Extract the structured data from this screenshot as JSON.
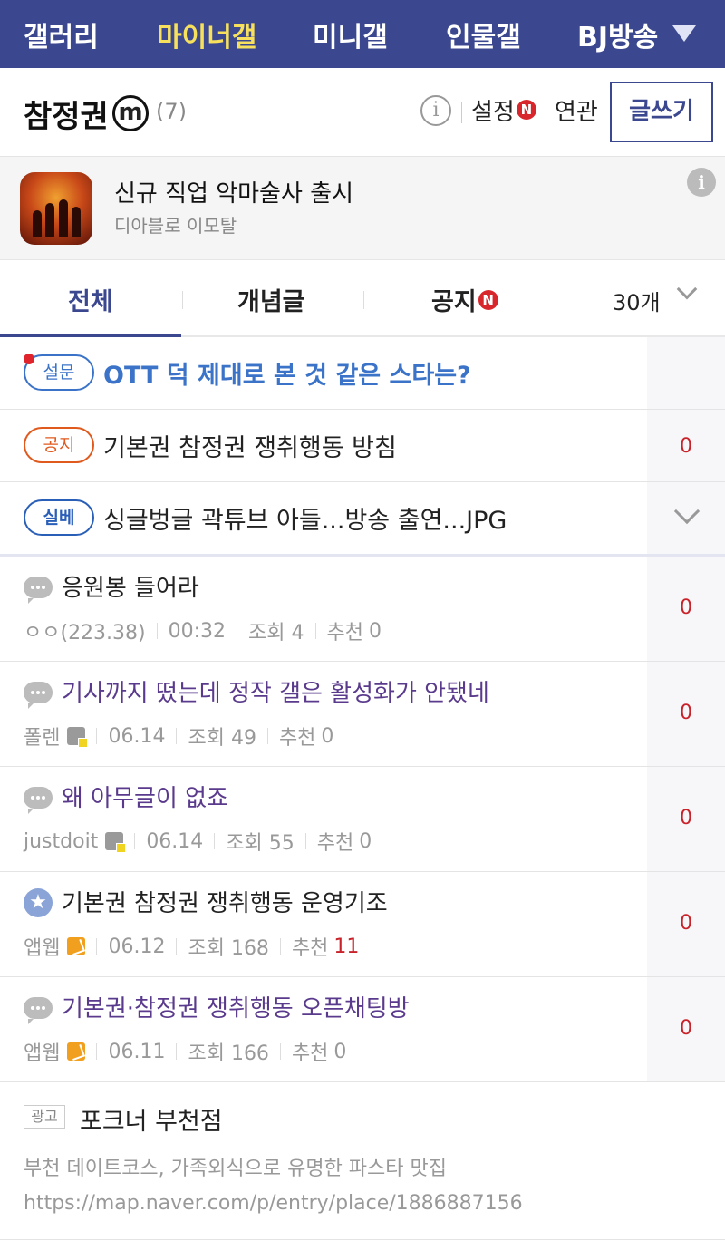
{
  "topnav": {
    "tabs": [
      "갤러리",
      "마이너갤",
      "미니갤",
      "인물갤",
      "BJ방송"
    ],
    "active_index": 1
  },
  "gallery": {
    "title": "참정권",
    "badge": "m",
    "count": "(7)",
    "settings_label": "설정",
    "settings_badge": "N",
    "related_label": "연관",
    "write_label": "글쓰기"
  },
  "ad_banner": {
    "title": "신규 직업 악마술사 출시",
    "subtitle": "디아블로 이모탈"
  },
  "list_tabs": {
    "tabs": [
      "전체",
      "개념글",
      "공지"
    ],
    "notice_badge": "N",
    "count_select": "30개"
  },
  "notices": [
    {
      "tag": "설문",
      "title": "OTT 덕 제대로 본 것 같은 스타는?",
      "count": ""
    },
    {
      "tag": "공지",
      "title": "기본권 참정권 쟁취행동 방침",
      "count": "0"
    },
    {
      "tag": "실베",
      "title": "싱글벙글 곽튜브 아들...방송 출연...JPG",
      "count": ""
    }
  ],
  "posts": [
    {
      "title": "응원봉 들어라",
      "author": "ㅇㅇ(223.38)",
      "date": "00:32",
      "views": "조회 4",
      "recommend_label": "추천",
      "recommend": "0",
      "replies": "0"
    },
    {
      "title": "기사까지 떴는데 정작 갤은 활성화가 안됐네",
      "author": "폴렌",
      "date": "06.14",
      "views": "조회 49",
      "recommend_label": "추천",
      "recommend": "0",
      "replies": "0"
    },
    {
      "title": "왜 아무글이 없죠",
      "author": "justdoit",
      "date": "06.14",
      "views": "조회 55",
      "recommend_label": "추천",
      "recommend": "0",
      "replies": "0"
    },
    {
      "title": "기본권 참정권 쟁취행동 운영기조",
      "author": "앱웹",
      "date": "06.12",
      "views": "조회 168",
      "recommend_label": "추천",
      "recommend": "11",
      "replies": "0"
    },
    {
      "title": "기본권·참정권 쟁취행동 오픈채팅방",
      "author": "앱웹",
      "date": "06.11",
      "views": "조회 166",
      "recommend_label": "추천",
      "recommend": "0",
      "replies": "0"
    }
  ],
  "ad_post": {
    "label": "광고",
    "title": "포크너 부천점",
    "description": "부천 데이트코스, 가족외식으로 유명한 파스타 맛집",
    "url": "https://map.naver.com/p/entry/place/1886887156"
  }
}
